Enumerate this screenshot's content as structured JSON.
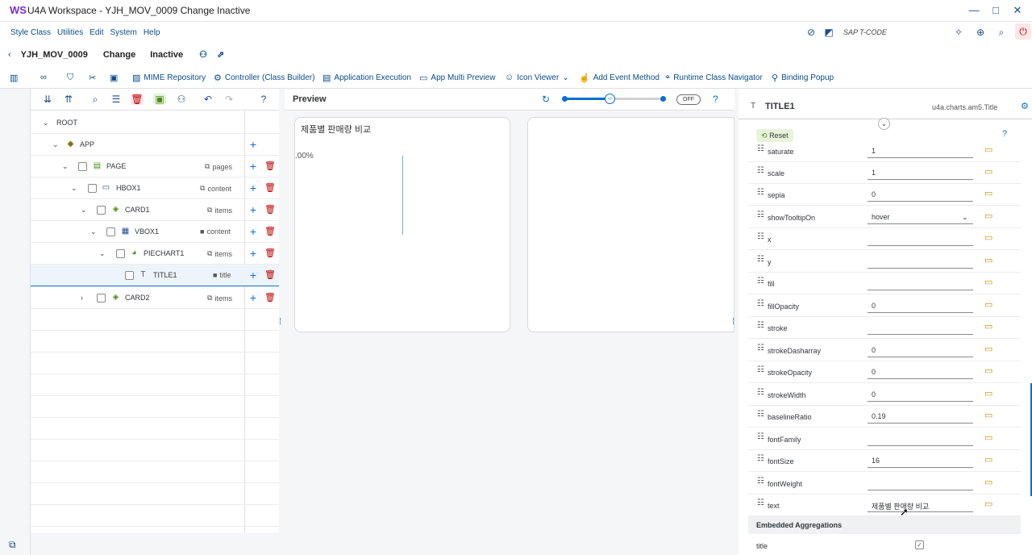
{
  "window": {
    "title": "U4A Workspace - YJH_MOV_0009 Change Inactive"
  },
  "menu": [
    "Style Class",
    "Utilities",
    "Edit",
    "System",
    "Help"
  ],
  "tcode": "SAP T-CODE",
  "header": {
    "app": "YJH_MOV_0009",
    "mode": "Change",
    "status": "Inactive"
  },
  "toolbar": {
    "mime": "MIME Repository",
    "controller": "Controller (Class Builder)",
    "exec": "Application Execution",
    "multi": "App Multi Preview",
    "icon": "Icon Viewer",
    "event": "Add Event Method",
    "runtime": "Runtime Class Navigator",
    "binding": "Binding Popup"
  },
  "tree": [
    {
      "label": "ROOT",
      "agg": ""
    },
    {
      "label": "APP",
      "agg": ""
    },
    {
      "label": "PAGE",
      "agg": "pages"
    },
    {
      "label": "HBOX1",
      "agg": "content"
    },
    {
      "label": "CARD1",
      "agg": "items"
    },
    {
      "label": "VBOX1",
      "agg": "content"
    },
    {
      "label": "PIECHART1",
      "agg": "items"
    },
    {
      "label": "TITLE1",
      "agg": "title"
    },
    {
      "label": "CARD2",
      "agg": "items"
    }
  ],
  "preview": {
    "label": "Preview",
    "toggle": "OFF",
    "card_title": "제품별 판매량 비교",
    "axis_label": ".00%"
  },
  "props": {
    "title": "TITLE1",
    "class": "u4a.charts.am5.Title",
    "reset": "Reset",
    "rows": [
      {
        "name": "saturate",
        "value": "1"
      },
      {
        "name": "scale",
        "value": "1"
      },
      {
        "name": "sepia",
        "value": "0"
      },
      {
        "name": "showTooltipOn",
        "value": "hover"
      },
      {
        "name": "x",
        "value": ""
      },
      {
        "name": "y",
        "value": ""
      },
      {
        "name": "fill",
        "value": ""
      },
      {
        "name": "fillOpacity",
        "value": "0"
      },
      {
        "name": "stroke",
        "value": ""
      },
      {
        "name": "strokeDasharray",
        "value": "0"
      },
      {
        "name": "strokeOpacity",
        "value": "0"
      },
      {
        "name": "strokeWidth",
        "value": "0"
      },
      {
        "name": "baselineRatio",
        "value": "0.19"
      },
      {
        "name": "fontFamily",
        "value": ""
      },
      {
        "name": "fontSize",
        "value": "16"
      },
      {
        "name": "fontWeight",
        "value": ""
      },
      {
        "name": "text",
        "value": "제품별 판매량 비교"
      }
    ],
    "embedded": "Embedded Aggregations",
    "embedded_item": "title"
  }
}
